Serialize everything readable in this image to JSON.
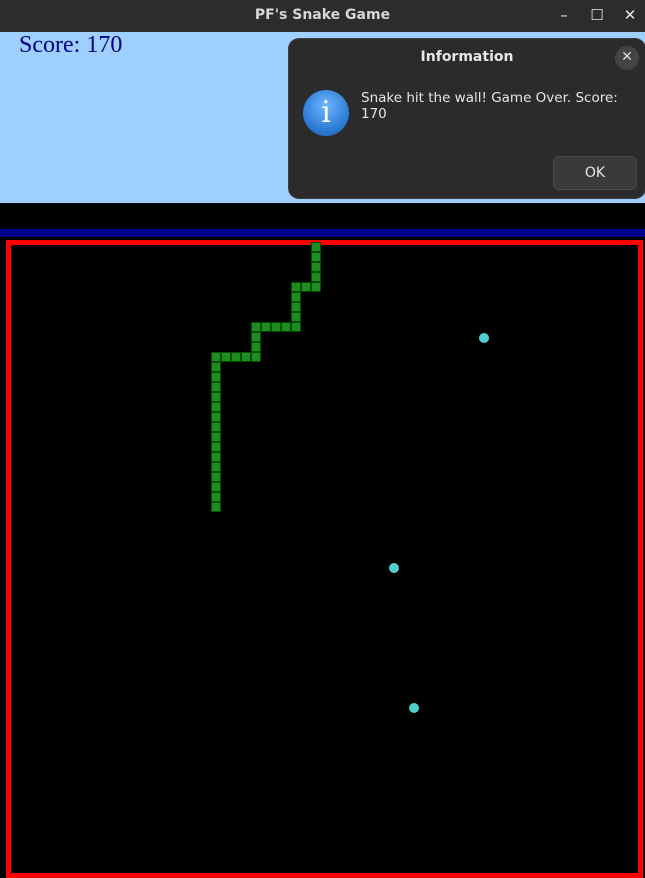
{
  "window": {
    "title": "PF's Snake Game",
    "minimize_glyph": "–",
    "maximize_glyph": "☐",
    "close_glyph": "✕"
  },
  "game": {
    "score_text": "Score: 170",
    "colors": {
      "score_bg": "#9fcfff",
      "score_text": "#00008b",
      "board_bg": "#000000",
      "wall": "#ff0000",
      "snake": "#1f8c1f",
      "food": "#4fd0d0"
    }
  },
  "dialog": {
    "title": "Information",
    "message": "Snake hit the wall! Game Over. Score: 170",
    "ok_label": "OK",
    "close_glyph": "✕",
    "icon": "info-icon"
  }
}
